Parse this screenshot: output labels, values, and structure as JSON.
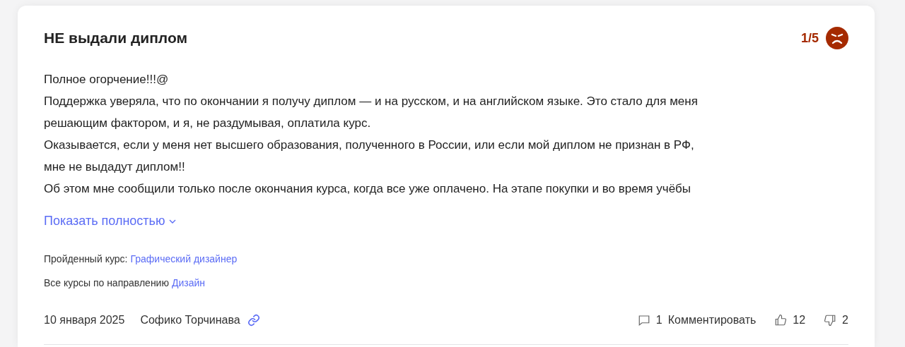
{
  "review": {
    "title": "НЕ выдали диплом",
    "rating": "1/5",
    "face": {
      "kind": "angry"
    },
    "paragraphs": [
      "Полное огорчение!!!@",
      "Поддержка уверяла, что по окончании я получу диплом — и на русском, и на английском языке. Это стало для меня решающим фактором, и я, не раздумывая, оплатила курс.",
      "Оказывается, если у меня нет высшего образования, полученного в России, или если мой диплом не признан в РФ, мне не выдадут диплом!!",
      "Об этом мне сообщили только после окончания курса, когда все уже оплачено. На этапе покупки и во время учёбы"
    ],
    "expand_link": "Показать полностью",
    "course_label": "Пройденный курс:",
    "course_link": "Графический дизайнер",
    "direction_label": "Все курсы по направлению",
    "direction_link": "Дизайн",
    "date": "10 января 2025",
    "author": "Софико Торчинава",
    "comments_count": "1",
    "comment_action": "Комментировать",
    "likes": "12",
    "dislikes": "2"
  }
}
